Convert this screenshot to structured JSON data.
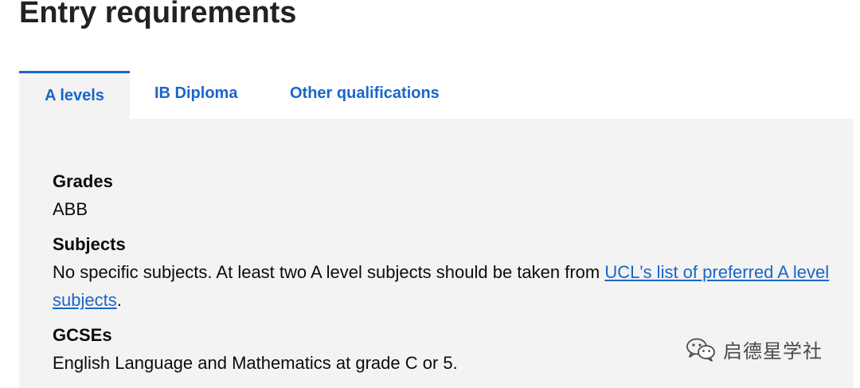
{
  "page": {
    "title": "Entry requirements"
  },
  "tabs": [
    {
      "label": "A levels",
      "active": true
    },
    {
      "label": "IB Diploma",
      "active": false
    },
    {
      "label": "Other qualifications",
      "active": false
    }
  ],
  "panel": {
    "grades_heading": "Grades",
    "grades_value": "ABB",
    "subjects_heading": "Subjects",
    "subjects_text_before": "No specific subjects. At least two A level subjects should be taken from ",
    "subjects_link": "UCL's list of preferred A level subjects",
    "subjects_text_after": ".",
    "gcses_heading": "GCSEs",
    "gcses_text": "English Language and Mathematics at grade C or 5."
  },
  "watermark": {
    "icon": "wechat-icon",
    "text": "启德星学社"
  },
  "colors": {
    "accent": "#1a66c9",
    "panel_bg": "#f3f3f3",
    "text": "#0b0c0c"
  }
}
